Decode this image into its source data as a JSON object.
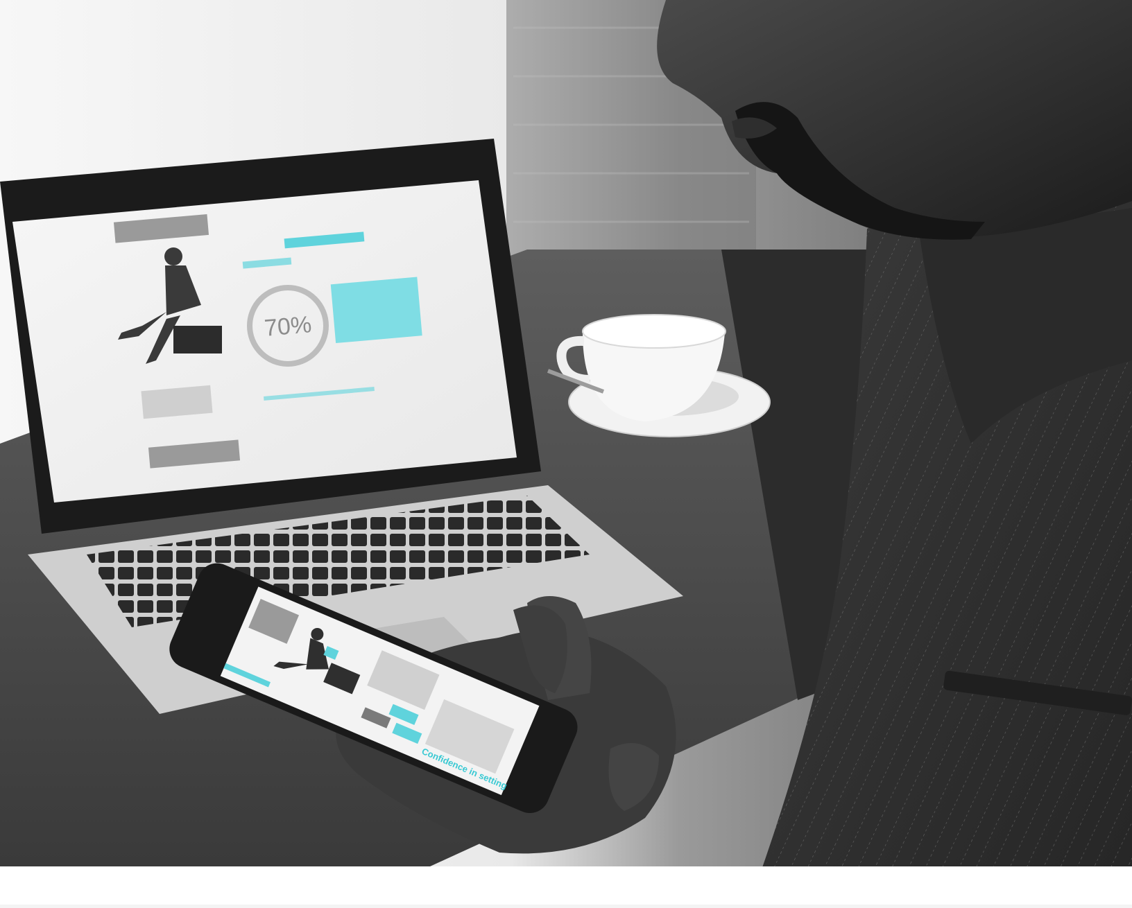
{
  "scene": {
    "type": "photo",
    "color_mode": "grayscale with cyan accents",
    "accent_color": "#5fd3dc",
    "subjects": [
      "person-holding-smartphone",
      "laptop",
      "coffee-cup",
      "table"
    ]
  },
  "laptop_screen": {
    "progress_ring_label": "70%"
  },
  "phone_screen": {
    "headline": "Confidence in setting"
  }
}
